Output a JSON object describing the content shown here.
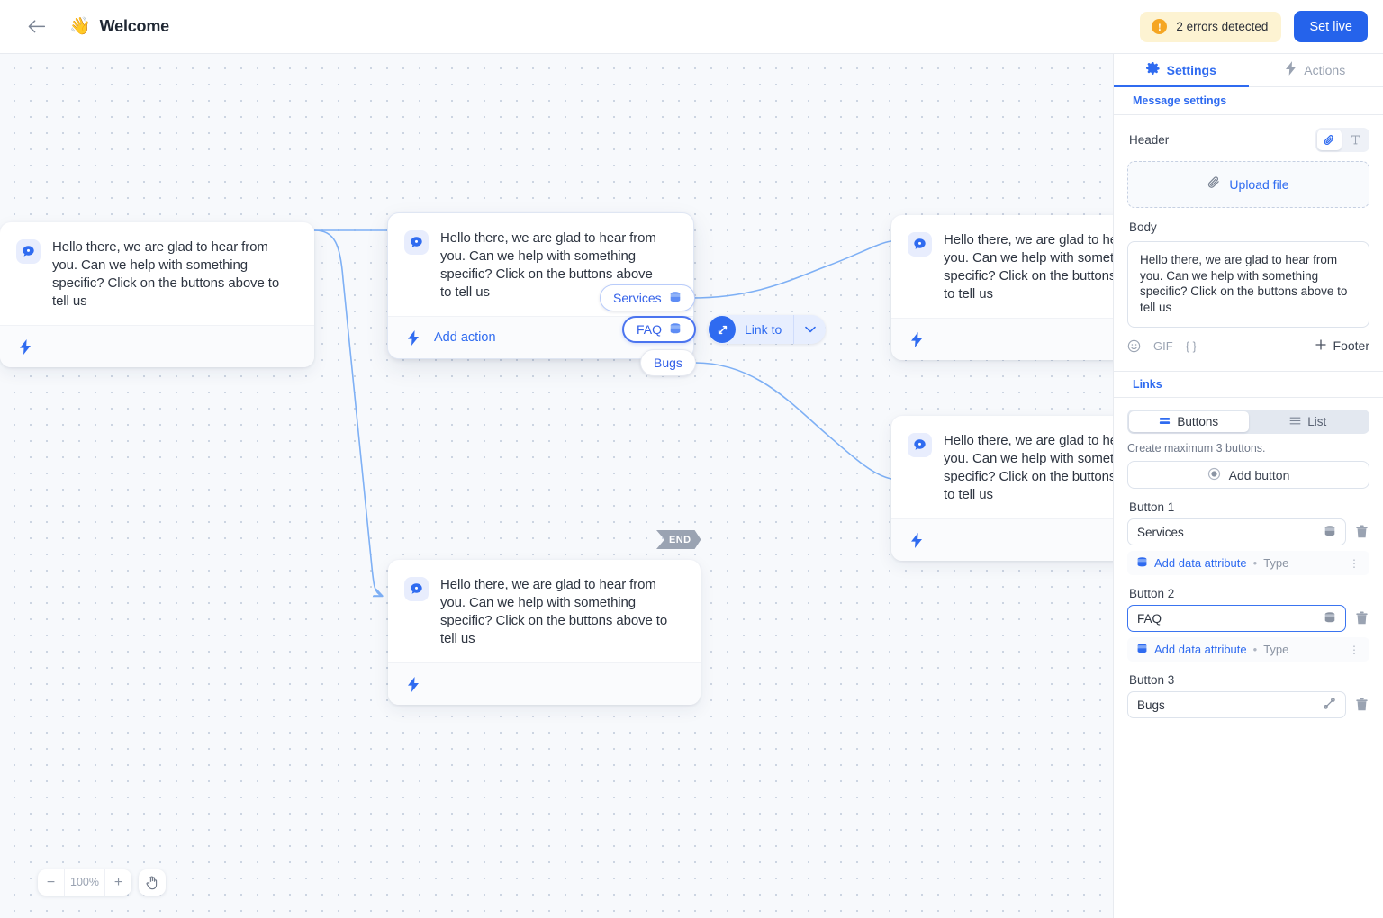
{
  "topbar": {
    "back_icon": "arrow-left-icon",
    "emoji": "👋",
    "title": "Welcome",
    "errors_text": "2 errors detected",
    "warn_glyph": "!",
    "set_live_label": "Set live",
    "accent": "#2563eb",
    "warn_bg": "#fdf3d2",
    "warn_icon_color": "#f5a623"
  },
  "canvas": {
    "message_text": "Hello there, we are glad to hear from you. Can we help with something specific? Click on the buttons above to tell us",
    "add_action_label": "Add action",
    "pills": {
      "services": "Services",
      "faq": "FAQ",
      "bugs": "Bugs"
    },
    "link_to_label": "Link to",
    "end_label": "END",
    "zoom": {
      "minus": "−",
      "level": "100%",
      "plus": "+",
      "hand_icon": "hand-pan-icon"
    }
  },
  "panel": {
    "tabs": [
      {
        "label": "Settings",
        "icon": "gear-icon",
        "active": true
      },
      {
        "label": "Actions",
        "icon": "bolt-icon",
        "active": false
      }
    ],
    "subtab": "Message settings",
    "header": {
      "label": "Header",
      "toggle": [
        {
          "icon": "paperclip-icon",
          "active": true
        },
        {
          "icon": "text-format-icon",
          "active": false
        }
      ],
      "upload_label": "Upload file"
    },
    "body": {
      "label": "Body",
      "value": "Hello there, we are glad to hear from you. Can we help with something specific? Click on the buttons above to tell us",
      "toolbar": {
        "emoji": "☺",
        "gif": "GIF",
        "vars": "{ }",
        "footer_label": "Footer",
        "footer_plus": "+"
      }
    },
    "links": {
      "title": "Links",
      "modes": [
        {
          "label": "Buttons",
          "icon": "buttons-icon",
          "active": true
        },
        {
          "label": "List",
          "icon": "list-icon",
          "active": false
        }
      ],
      "hint": "Create maximum 3 buttons.",
      "add_button_label": "Add button",
      "attribute_link": "Add data attribute",
      "attribute_sep": "•",
      "attribute_type": "Type",
      "buttons": [
        {
          "label": "Button 1",
          "value": "Services",
          "icon": "database-icon",
          "focused": false,
          "has_attr_row": true
        },
        {
          "label": "Button 2",
          "value": "FAQ",
          "icon": "database-icon",
          "focused": true,
          "has_attr_row": true
        },
        {
          "label": "Button 3",
          "value": "Bugs",
          "icon": "link-diagonal-icon",
          "focused": false,
          "has_attr_row": false
        }
      ]
    }
  }
}
